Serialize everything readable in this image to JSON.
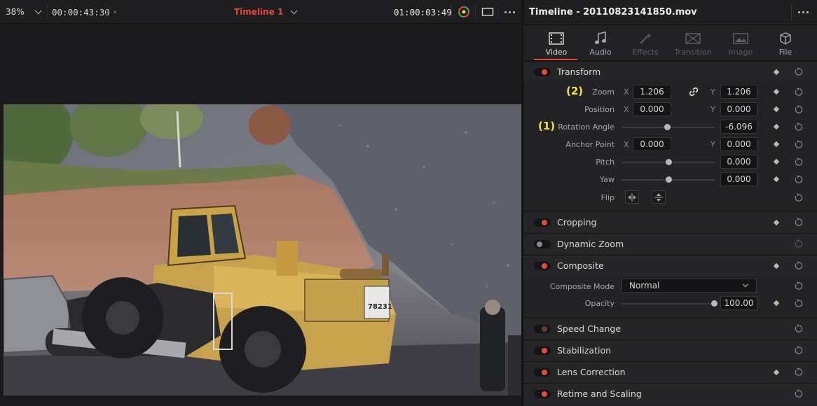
{
  "viewer": {
    "zoom": "38%",
    "timecode_left": "00:00:43:30",
    "timeline_name": "Timeline 1",
    "timecode_right": "01:00:03:49"
  },
  "inspector": {
    "title": "Timeline - 20110823141850.mov",
    "tabs": [
      {
        "label": "Video",
        "state": "active",
        "icon": "film-icon"
      },
      {
        "label": "Audio",
        "state": "normal",
        "icon": "music-note-icon"
      },
      {
        "label": "Effects",
        "state": "disabled",
        "icon": "magic-wand-icon"
      },
      {
        "label": "Transition",
        "state": "disabled",
        "icon": "transition-icon"
      },
      {
        "label": "Image",
        "state": "disabled",
        "icon": "image-icon"
      },
      {
        "label": "File",
        "state": "normal",
        "icon": "file-cube-icon"
      }
    ],
    "transform": {
      "label": "Transform",
      "zoom": {
        "label": "Zoom",
        "annotation": "(2)",
        "x_axis": "X",
        "x": "1.206",
        "y_axis": "Y",
        "y": "1.206"
      },
      "position": {
        "label": "Position",
        "x_axis": "X",
        "x": "0.000",
        "y_axis": "Y",
        "y": "0.000"
      },
      "rotation": {
        "label": "Rotation Angle",
        "annotation": "(1)",
        "value": "-6.096"
      },
      "anchor": {
        "label": "Anchor Point",
        "x_axis": "X",
        "x": "0.000",
        "y_axis": "Y",
        "y": "0.000"
      },
      "pitch": {
        "label": "Pitch",
        "value": "0.000"
      },
      "yaw": {
        "label": "Yaw",
        "value": "0.000"
      },
      "flip": {
        "label": "Flip"
      }
    },
    "cropping": {
      "label": "Cropping"
    },
    "dynamic_zoom": {
      "label": "Dynamic Zoom"
    },
    "composite": {
      "label": "Composite",
      "mode_label": "Composite Mode",
      "mode_value": "Normal",
      "opacity_label": "Opacity",
      "opacity_value": "100.00"
    },
    "speed_change": {
      "label": "Speed Change"
    },
    "stabilization": {
      "label": "Stabilization"
    },
    "lens_correction": {
      "label": "Lens Correction"
    },
    "retime_scaling": {
      "label": "Retime and Scaling"
    }
  },
  "colors": {
    "accent": "#e8473a",
    "annotation": "#f5e43a",
    "panel_bg": "#232325"
  }
}
